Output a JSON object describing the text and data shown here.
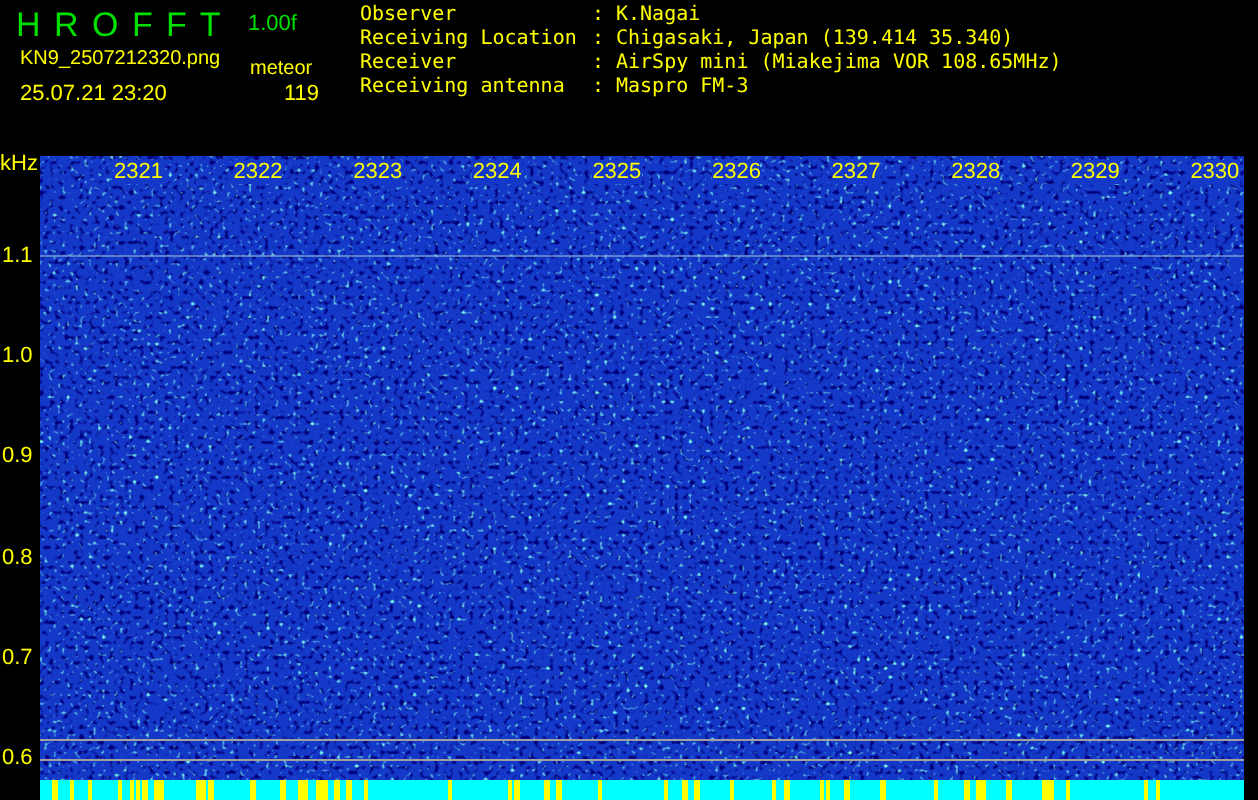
{
  "app": {
    "title": "H R O F F T",
    "version": "1.00f",
    "file": "KN9_2507212320.png",
    "counter_label": "meteor",
    "timestamp": "25.07.21 23:20",
    "count": "119"
  },
  "station": [
    {
      "label": "Observer",
      "separator": ":",
      "value": "K.Nagai"
    },
    {
      "label": "Receiving Location",
      "separator": ":",
      "value": "Chigasaki, Japan (139.414 35.340)"
    },
    {
      "label": "Receiver",
      "separator": ":",
      "value": "AirSpy mini (Miakejima VOR 108.65MHz)"
    },
    {
      "label": "Receiving antenna",
      "separator": ":",
      "value": "Maspro FM-3"
    }
  ],
  "plot": {
    "unit": "kHz",
    "time_labels": [
      "2321",
      "2322",
      "2323",
      "2324",
      "2325",
      "2326",
      "2327",
      "2328",
      "2329",
      "2330"
    ],
    "freq_labels": [
      "1.1",
      "1.0",
      "0.9",
      "0.8",
      "0.7",
      "0.6"
    ]
  }
}
